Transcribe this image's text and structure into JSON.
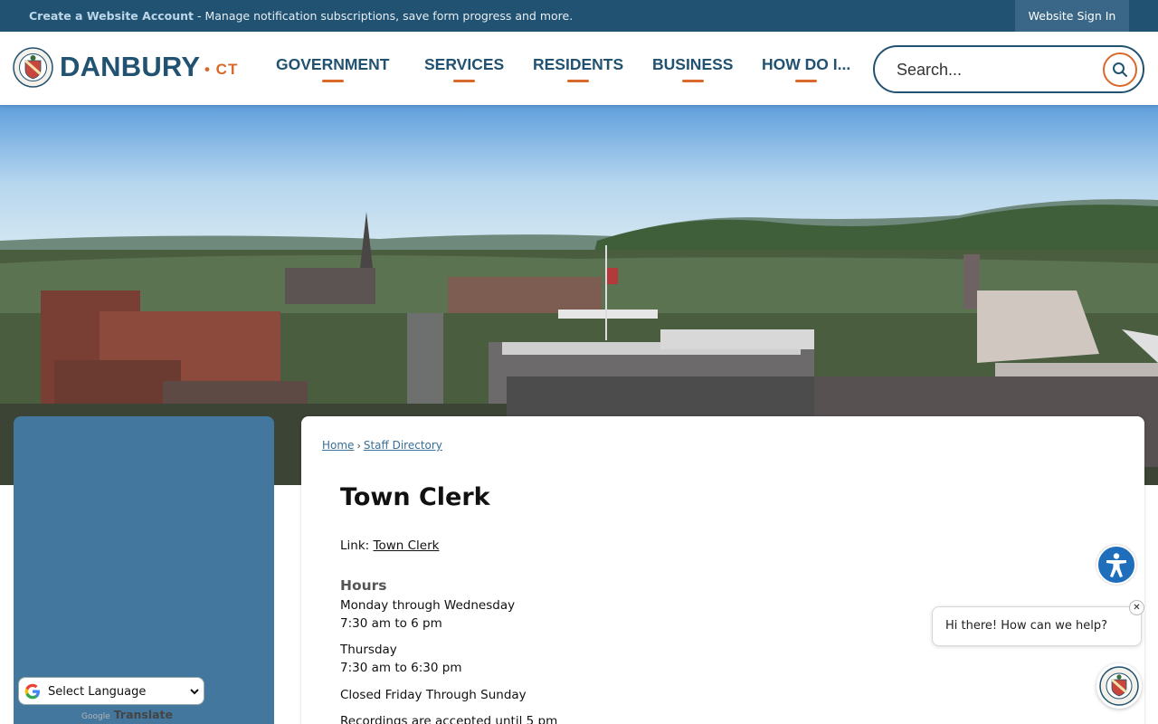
{
  "topbar": {
    "account_link": "Create a Website Account",
    "account_text": "- Manage notification subscriptions, save form progress and more.",
    "signin_label": "Website Sign In"
  },
  "header": {
    "logo_text": "DANBURY",
    "logo_suffix": "• CT",
    "nav": [
      {
        "label": "GOVERNMENT"
      },
      {
        "label": "SERVICES"
      },
      {
        "label": "RESIDENTS"
      },
      {
        "label": "BUSINESS"
      },
      {
        "label": "HOW DO I..."
      }
    ],
    "search_placeholder": "Search..."
  },
  "breadcrumb": {
    "home": "Home",
    "separator": "›",
    "current": "Staff Directory"
  },
  "content": {
    "title": "Town Clerk",
    "link_prefix": "Link:",
    "link_text": "Town Clerk",
    "hours_heading": "Hours",
    "lines": [
      "Monday through Wednesday",
      "7:30 am to 6 pm",
      "Thursday",
      "7:30 am to 6:30 pm",
      "Closed Friday Through Sunday",
      "Recordings are accepted until 5 pm"
    ]
  },
  "translate": {
    "select_label": "Select Language",
    "powered_google": "Google",
    "powered_label": "Translate"
  },
  "chat": {
    "message": "Hi there! How can we help?",
    "close_glyph": "✕"
  },
  "colors": {
    "brand_navy": "#215272",
    "accent_orange": "#d9692b",
    "sidebar_blue": "#44779e",
    "accessibility_blue": "#1f6ebc"
  }
}
